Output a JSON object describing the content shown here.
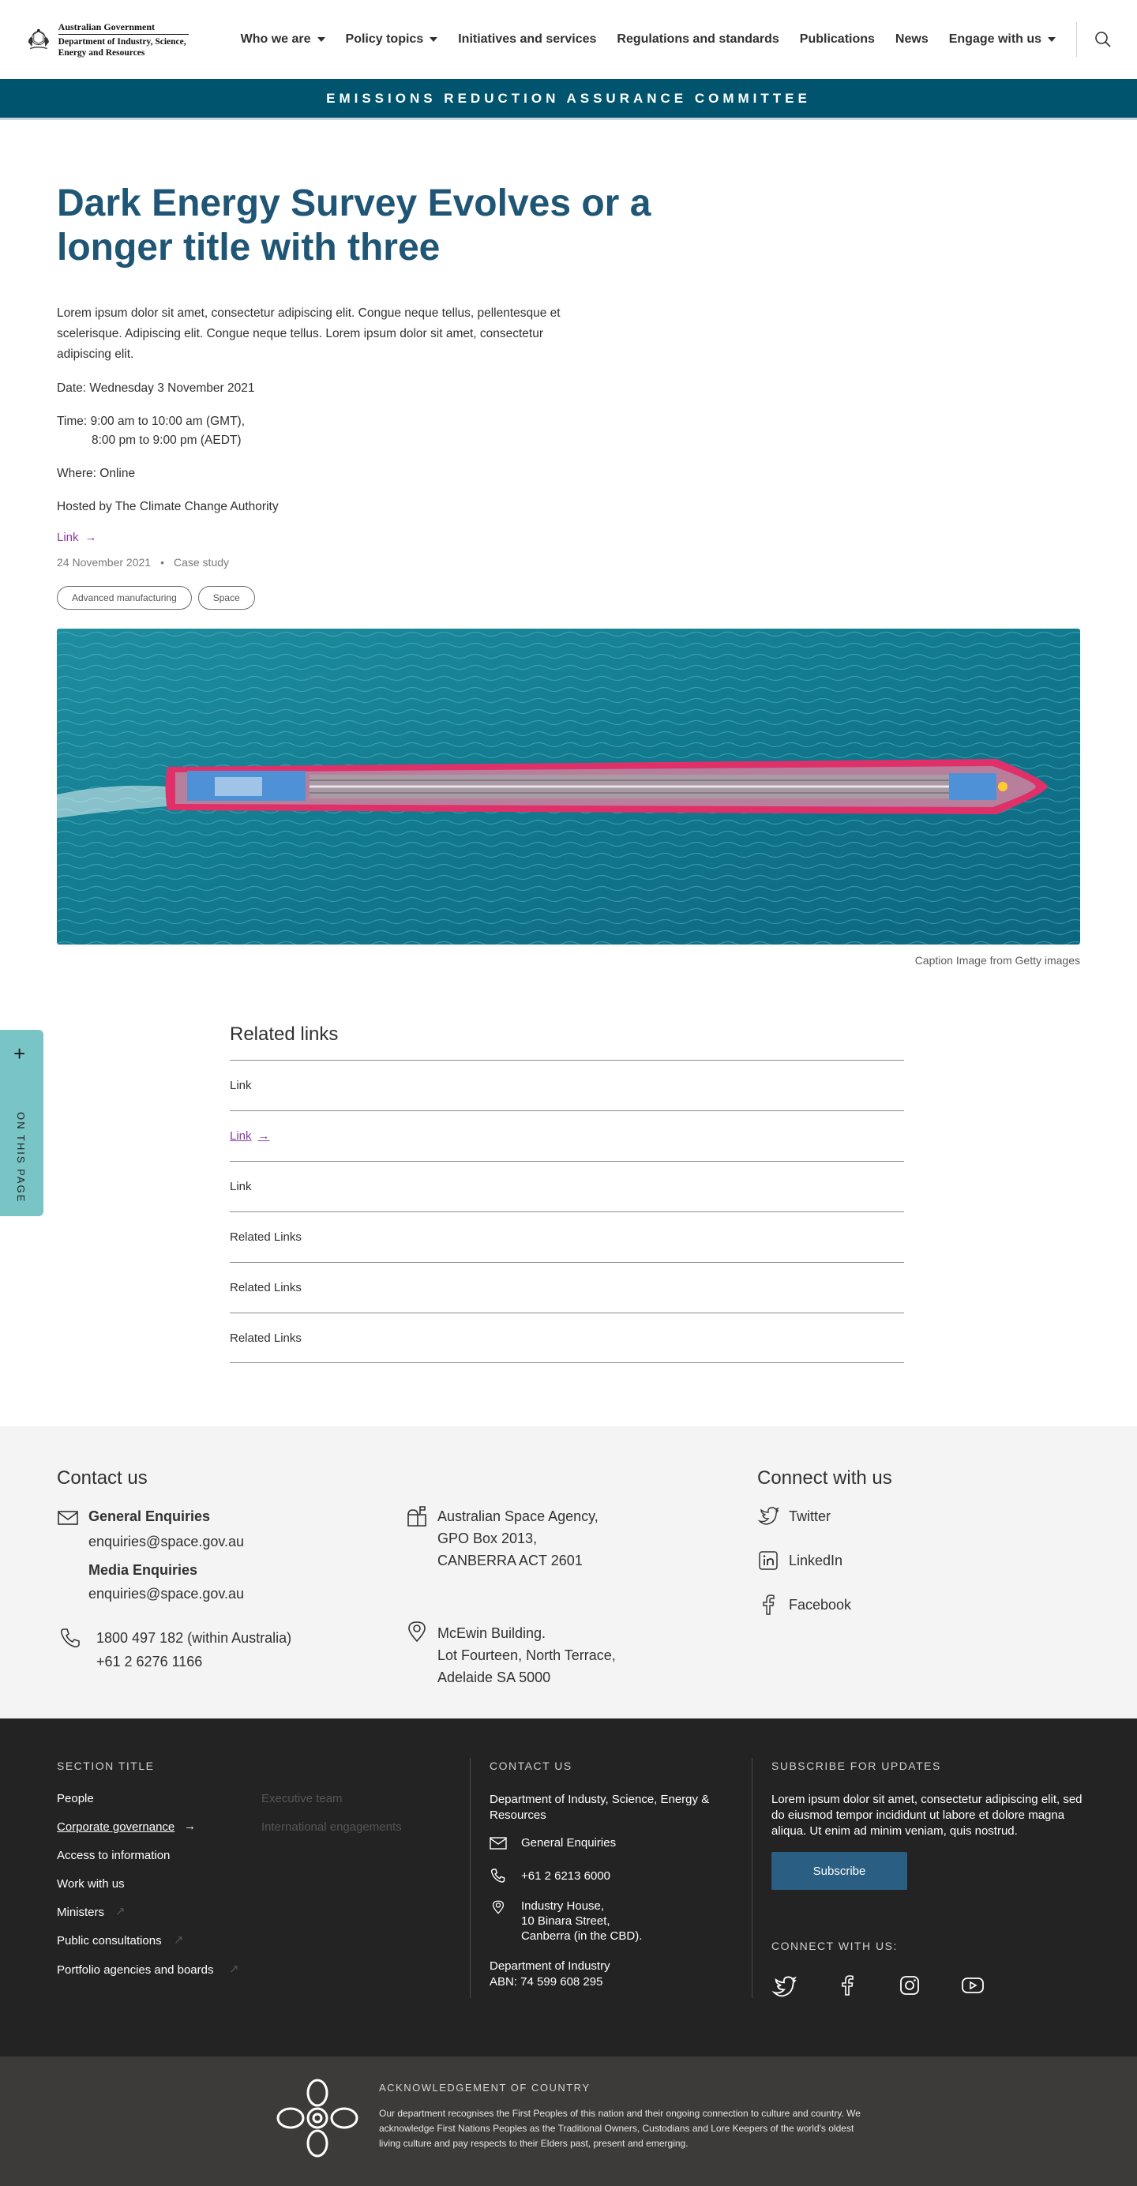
{
  "header": {
    "logo": {
      "gov": "Australian Government",
      "dept": "Department of Industry, Science, Energy and Resources"
    },
    "nav": [
      {
        "label": "Who we are",
        "dropdown": true
      },
      {
        "label": "Policy topics",
        "dropdown": true
      },
      {
        "label": "Initiatives and services",
        "dropdown": false
      },
      {
        "label": "Regulations and standards",
        "dropdown": false
      },
      {
        "label": "Publications",
        "dropdown": false
      },
      {
        "label": "News",
        "dropdown": false
      },
      {
        "label": "Engage with us",
        "dropdown": true
      }
    ],
    "search_icon": "search-icon"
  },
  "banner": {
    "label": "EMISSIONS REDUCTION ASSURANCE COMMITTEE",
    "color": "#00546e"
  },
  "page": {
    "title": "Dark Energy Survey Evolves or a longer title with three",
    "intro": "Lorem ipsum dolor sit amet, consectetur adipiscing elit. Congue neque tellus, pellentesque et scelerisque. Adipiscing elit. Congue neque tellus. Lorem ipsum dolor sit amet, consectetur adipiscing elit.",
    "date": "Date: Wednesday 3 November 2021",
    "time_line1": "Time: 9:00 am to 10:00 am (GMT),",
    "time_line2": "8:00 pm to 9:00 pm (AEDT)",
    "where": "Where: Online",
    "host": "Hosted by The Climate Change Authority",
    "link": "Link",
    "published": "24 November 2021",
    "content_type": "Case study",
    "tags": [
      "Advanced manufacturing",
      "Space"
    ],
    "caption": "Caption Image from Getty images"
  },
  "on_this_page": {
    "label": "ON THIS PAGE",
    "icon": "plus-icon"
  },
  "related": {
    "title": "Related links",
    "items": [
      "Link",
      "Link",
      "Link",
      "Related Links",
      "Related Links",
      "Related Links"
    ]
  },
  "contact": {
    "title": "Contact us",
    "general_label": "General Enquiries",
    "general_email": "enquiries@space.gov.au",
    "media_label": "Media Enquiries",
    "media_email": "enquiries@space.gov.au",
    "phone1": "1800 497 182 (within Australia)",
    "phone2": "+61 2 6276 1166",
    "postal1": "Australian Space Agency,",
    "postal2": "GPO Box 2013,",
    "postal3": "CANBERRA ACT 2601",
    "street1": "McEwin Building.",
    "street2": "Lot Fourteen, North Terrace,",
    "street3": "Adelaide SA 5000",
    "connect_title": "Connect with us",
    "social": [
      "Twitter",
      "LinkedIn",
      "Facebook"
    ]
  },
  "footer": {
    "section_title": "SECTION TITLE",
    "links": [
      "People",
      "Corporate governance",
      "Access to information",
      "Work with us",
      "Ministers",
      "Public consultations",
      "Portfolio agencies and boards"
    ],
    "sub_links": [
      "Executive team",
      "International engagements"
    ],
    "contact_title": "CONTACT US",
    "dept": "Department of Industy, Science, Energy & Resources",
    "enquiries": "General Enquiries",
    "phone": "+61 2 6213 6000",
    "addr1": "Industry House,",
    "addr2": "10 Binara Street,",
    "addr3": "Canberra (in the CBD).",
    "dept_name": "Department of Industry",
    "abn": "ABN: 74 599 608 295",
    "subscribe_title": "SUBSCRIBE FOR UPDATES",
    "subscribe_text": "Lorem ipsum dolor sit amet, consectetur adipiscing elit, sed do eiusmod tempor incididunt ut labore et dolore magna aliqua. Ut enim ad minim veniam, quis nostrud.",
    "subscribe_button": "Subscribe",
    "connect_title": "CONNECT WITH US:",
    "connect_icons": [
      "twitter-icon",
      "facebook-icon",
      "instagram-icon",
      "youtube-icon"
    ]
  },
  "acknowledgement": {
    "title": "ACKNOWLEDGEMENT OF COUNTRY",
    "text": "Our department recognises the First Peoples of this nation and their ongoing connection to culture and country. We acknowledge First Nations Peoples as the Traditional Owners, Custodians and Lore Keepers of the world's oldest living culture and pay respects to their Elders past, present and emerging."
  }
}
